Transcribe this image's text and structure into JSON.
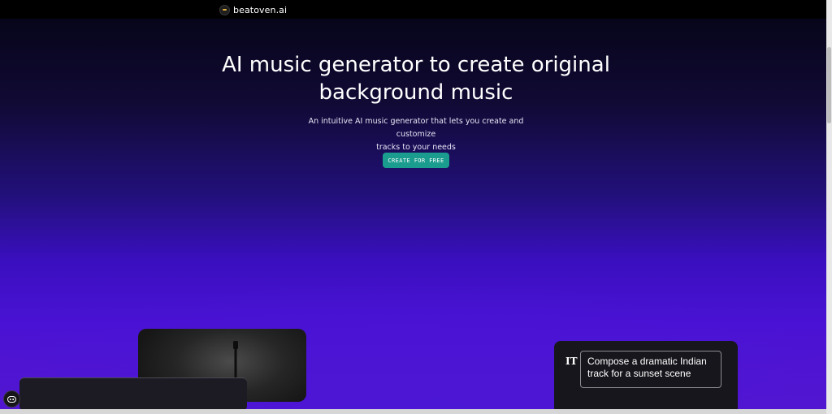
{
  "header": {
    "brand_name": "beatoven.ai",
    "logo_icon": "beatoven-logo-icon"
  },
  "hero": {
    "title_line1": "AI music generator to create original",
    "title_line2": "background music",
    "subtitle_line1": "An intuitive AI music generator that lets you create and customize",
    "subtitle_line2": "tracks to your needs",
    "cta_label": "CREATE FOR FREE"
  },
  "prompt_card": {
    "text_icon_glyph": "IT",
    "prompt_line1": "Compose a dramatic Indian",
    "prompt_line2": "track for a sunset scene"
  },
  "chat": {
    "icon": "chat-bubble-icon"
  },
  "colors": {
    "accent": "#1a9c8e",
    "hero_top": "#07051a",
    "hero_bottom": "#4a12d4"
  }
}
